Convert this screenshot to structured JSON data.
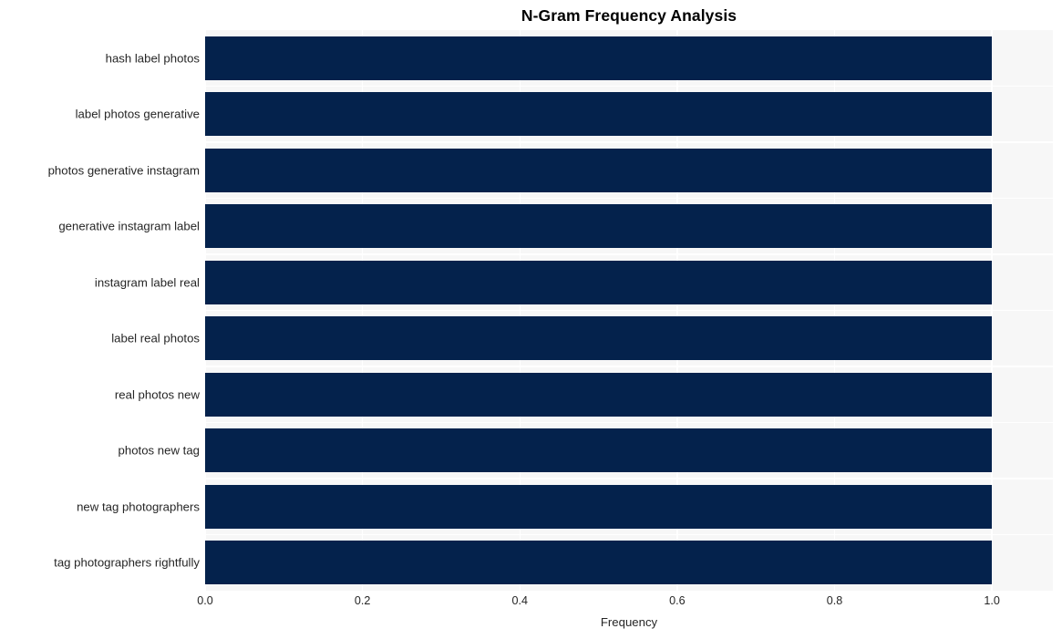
{
  "chart_data": {
    "type": "bar",
    "orientation": "horizontal",
    "title": "N-Gram Frequency Analysis",
    "xlabel": "Frequency",
    "ylabel": "",
    "xlim": [
      0.0,
      1.0775
    ],
    "xticks": [
      "0.0",
      "0.2",
      "0.4",
      "0.6",
      "0.8",
      "1.0"
    ],
    "xtick_values": [
      0.0,
      0.2,
      0.4,
      0.6,
      0.8,
      1.0
    ],
    "grid": true,
    "grid_color": "#ffffff",
    "plot_background": "#f7f7f7",
    "bar_color": "#04224c",
    "legend": null,
    "categories": [
      "hash label photos",
      "label photos generative",
      "photos generative instagram",
      "generative instagram label",
      "instagram label real",
      "label real photos",
      "real photos new",
      "photos new tag",
      "new tag photographers",
      "tag photographers rightfully"
    ],
    "values": [
      1.0,
      1.0,
      1.0,
      1.0,
      1.0,
      1.0,
      1.0,
      1.0,
      1.0,
      1.0
    ]
  }
}
